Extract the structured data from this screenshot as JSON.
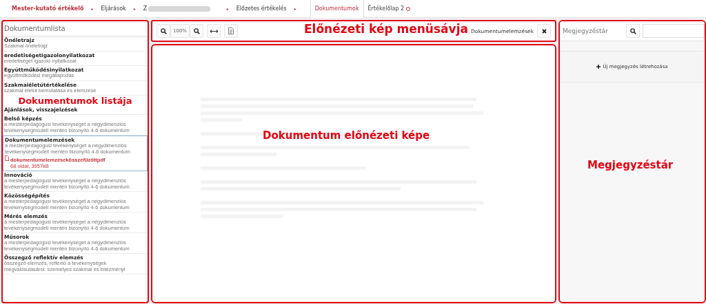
{
  "breadcrumb": [
    {
      "label": "Mester-kutató értékelő",
      "kind": "root",
      "separator": "▸"
    },
    {
      "label": "Eljárások",
      "kind": "link",
      "separator": "▸"
    },
    {
      "label": "Z",
      "kind": "redacted",
      "separator": "▸"
    },
    {
      "label": "Előzetes értékelés",
      "kind": "link",
      "separator": "▸"
    }
  ],
  "tabs": [
    {
      "label": "Dokumentumok",
      "selected": true
    },
    {
      "label": "Értékelőlap 2",
      "selected": false
    }
  ],
  "document_list": {
    "title": "Dokumentumlista",
    "annotation": "Dokumentumok listája",
    "items": [
      {
        "title": "Önéletrajz",
        "subtitle": "Szakmai önéletrajz",
        "selected": false
      },
      {
        "title": "eredetiségetigazolonyilatkozat",
        "subtitle": "eredetiséget igazoló nyilatkozat",
        "selected": false
      },
      {
        "title": "Együttműködésinyilatkozat",
        "subtitle": "együttműködési megállapodás",
        "selected": false
      },
      {
        "title": "Szakmaiéletútértékelése",
        "subtitle": "szakmai életút bemutatása és elemzése",
        "selected": false
      },
      {
        "title": "Ajánlások, visszajelzések",
        "selected": false
      },
      {
        "title": "Belső képzés",
        "subtitle": "a mesterpedagógusi tevékenységet a négydimenziós tevékenységmodell mentén bizonyító 4-6 dokumentum",
        "selected": false
      },
      {
        "title": "Dokumentumelemzések",
        "subtitle": "a mesterpedagógusi tevékenységet a négydimenziós tevékenységmodell mentén bizonyító 4-6 dokumentum",
        "selected": true,
        "file": {
          "name": "dokumentumelemzésekösszefűzöttpdf",
          "info": "68 oldal, 3957kB"
        }
      },
      {
        "title": "Innováció",
        "subtitle": "a mesterpedagógusi tevékenységet a négydimenziós tevékenységmodell mentén bizonyító 4-6 dokumentum",
        "selected": false
      },
      {
        "title": "Közösségépítés",
        "subtitle": "a mesterpedagógusi tevékenységet a négydimenziós tevékenységmodell mentén bizonyító 4-6 dokumentum",
        "selected": false
      },
      {
        "title": "Mérés elemzés",
        "subtitle": "a mesterpedagógusi tevékenységet a négydimenziós tevékenységmodell mentén bizonyító 4-6 dokumentum",
        "selected": false
      },
      {
        "title": "Műsorok",
        "subtitle": "a mesterpedagógusi tevékenységet a négydimenziós tevékenységmodell mentén bizonyító 4-6 dokumentum",
        "selected": false
      },
      {
        "title": "Összegző reflektív elemzés",
        "subtitle": "összegző elemzés, reflexió a tevékenységek megvalósulásáról: személyes szakmai és intézményi",
        "selected": false
      }
    ]
  },
  "toolbar": {
    "zoom": "100%",
    "document_name": "Dokumentumelemzések",
    "annotation": "Előnézeti kép menüsávja"
  },
  "preview": {
    "annotation": "Dokumentum előnézeti képe"
  },
  "notes": {
    "title": "Megjegyzéstár",
    "new_note": "Új megjegyzés létrehozása",
    "annotation": "Megjegyzéstár"
  }
}
